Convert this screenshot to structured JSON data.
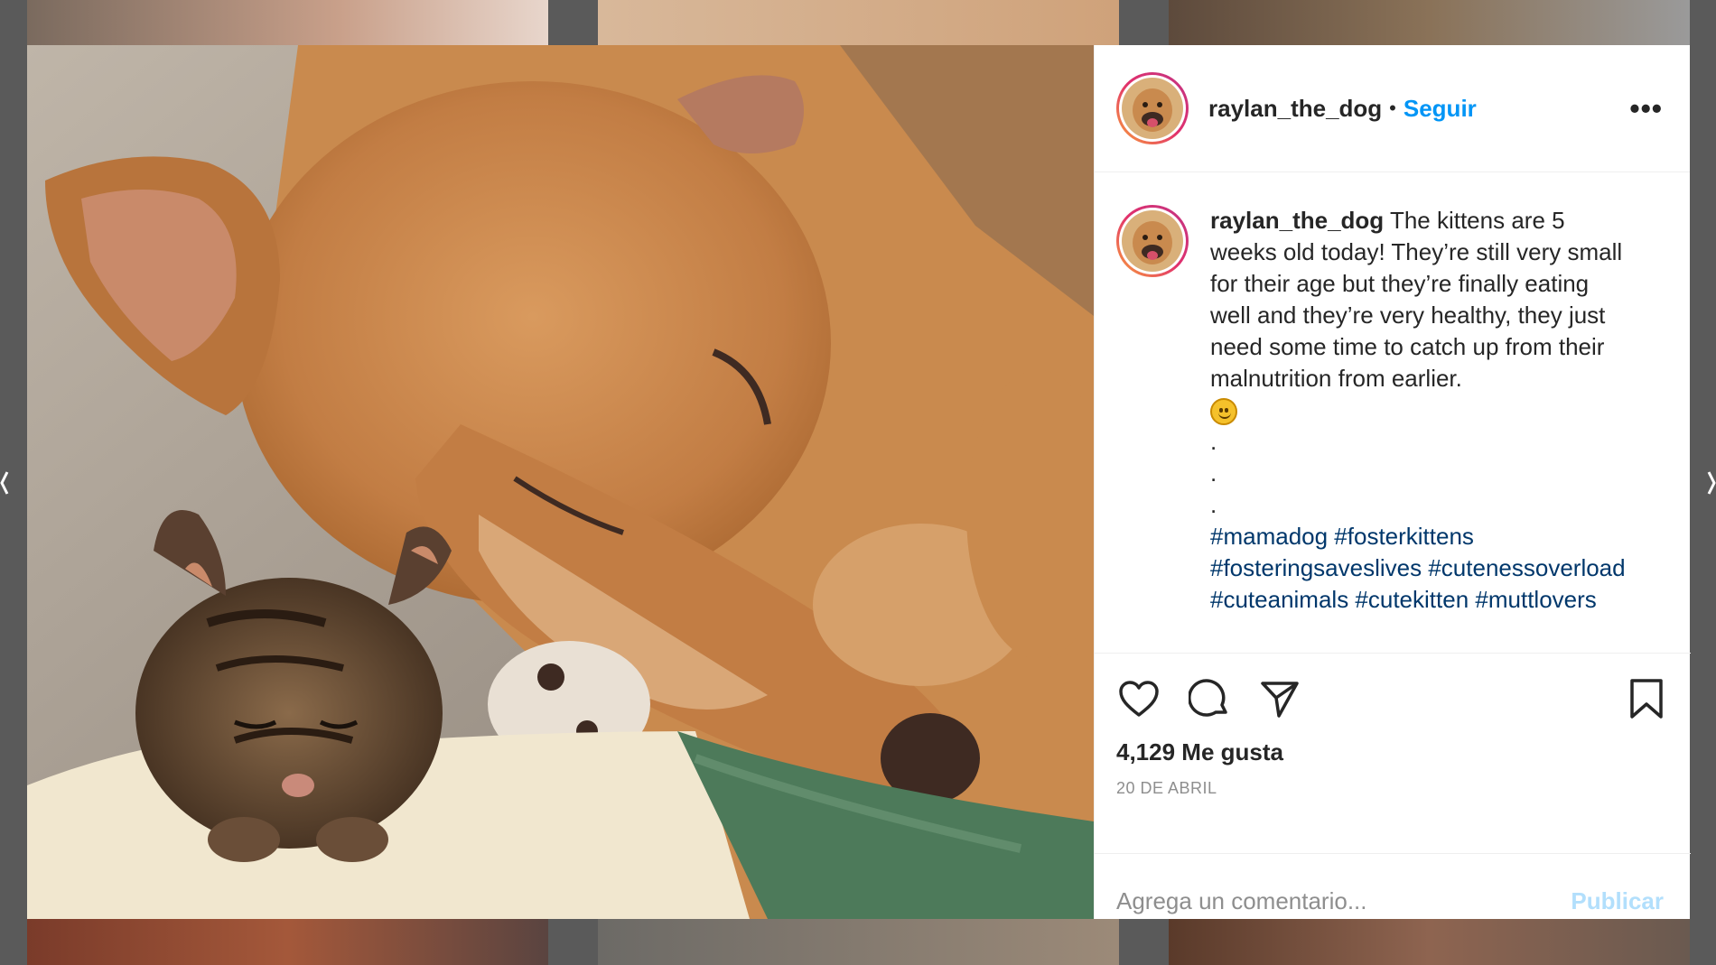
{
  "post": {
    "username": "raylan_the_dog",
    "follow_label": "Seguir",
    "more_label": "•••",
    "caption": {
      "username": "raylan_the_dog",
      "text": "The kittens are 5 weeks old today! They’re still very small for their age but they’re finally eating well and they’re very healthy, they just need some time to catch up from their malnutrition from earlier.",
      "dots": [
        ".",
        ".",
        "."
      ],
      "hashtags": "#mamadog #fosterkittens #fosteringsaveslives #cutenessoverload #cuteanimals #cutekitten #muttlovers"
    },
    "likes": "4,129 Me gusta",
    "date": "20 DE ABRIL"
  },
  "add_comment": {
    "placeholder": "Agrega un comentario...",
    "publish_label": "Publicar"
  },
  "icons": {
    "like": "heart-icon",
    "comment": "comment-icon",
    "share": "send-icon",
    "save": "bookmark-icon",
    "emoji": "smiling-face-emoji"
  },
  "colors": {
    "link_blue": "#0095f6",
    "hashtag_blue": "#00376b",
    "publish_disabled": "#b2dffc",
    "muted_gray": "#8e8e8e",
    "text": "#262626"
  }
}
